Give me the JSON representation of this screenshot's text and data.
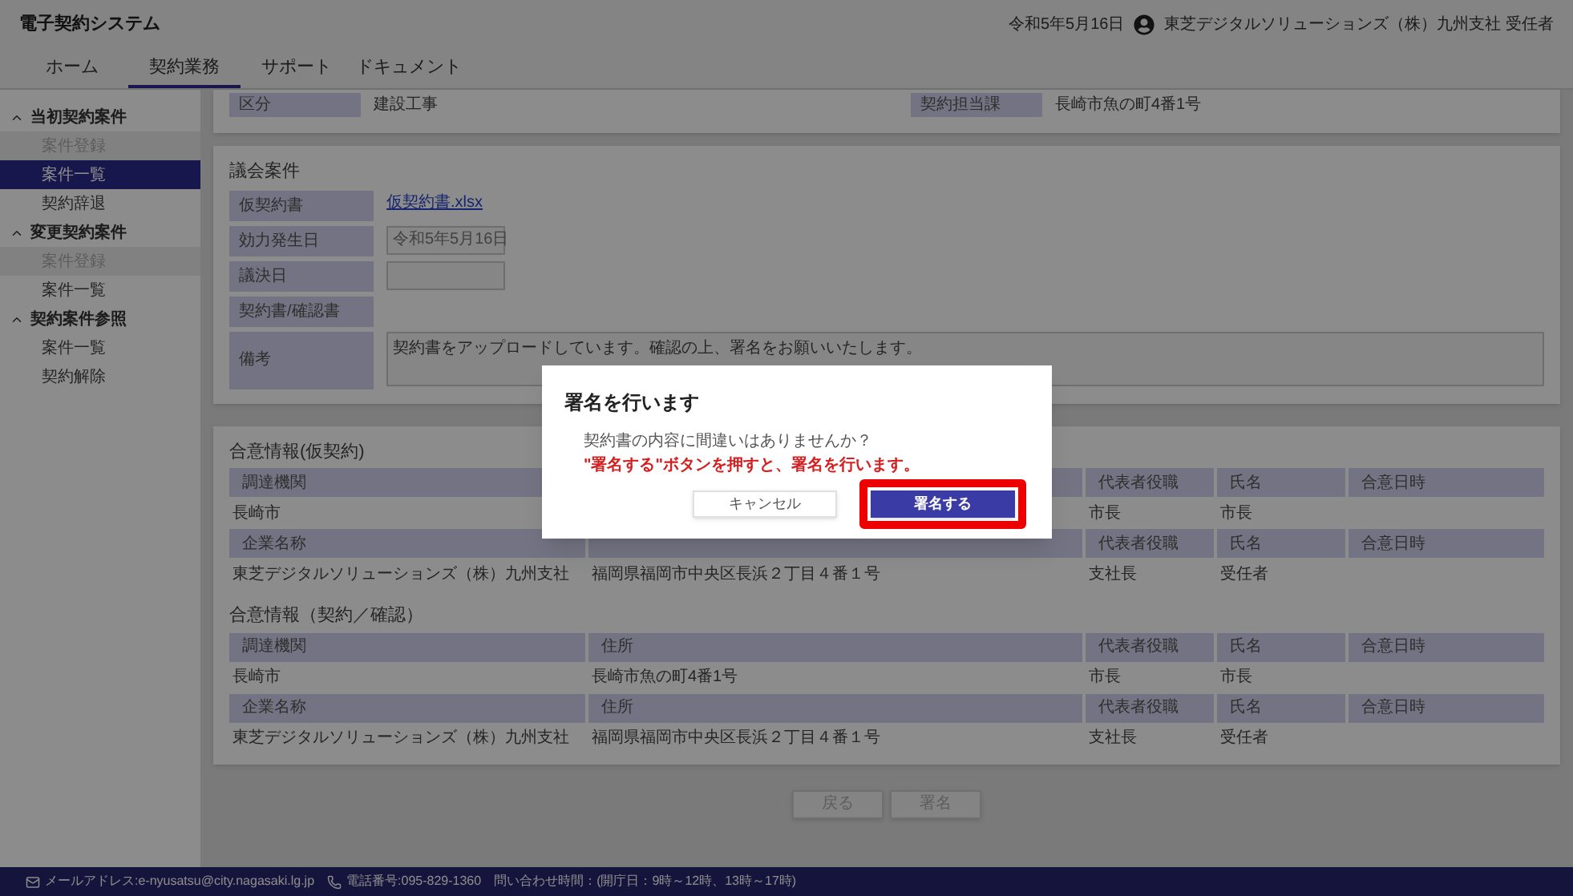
{
  "header": {
    "title": "電子契約システム",
    "date": "令和5年5月16日",
    "user": "東芝デジタルソリューションズ（株）九州支社 受任者"
  },
  "tabs": [
    {
      "label": "ホーム",
      "selected": false
    },
    {
      "label": "契約業務",
      "selected": true
    },
    {
      "label": "サポート",
      "selected": false
    },
    {
      "label": "ドキュメント",
      "selected": false
    }
  ],
  "sidebar": {
    "groups": [
      {
        "label": "当初契約案件",
        "expanded": true,
        "items": [
          {
            "label": "案件登録",
            "selected": false,
            "disabled": true
          },
          {
            "label": "案件一覧",
            "selected": true,
            "disabled": false
          },
          {
            "label": "契約辞退",
            "selected": false,
            "disabled": false
          }
        ]
      },
      {
        "label": "変更契約案件",
        "expanded": true,
        "items": [
          {
            "label": "案件登録",
            "selected": false,
            "disabled": true
          },
          {
            "label": "案件一覧",
            "selected": false,
            "disabled": false
          }
        ]
      },
      {
        "label": "契約案件参照",
        "expanded": true,
        "items": [
          {
            "label": "案件一覧",
            "selected": false,
            "disabled": false
          },
          {
            "label": "契約解除",
            "selected": false,
            "disabled": false
          }
        ]
      }
    ]
  },
  "basic_info": {
    "fields": [
      {
        "label": "区分",
        "value": "建設工事"
      },
      {
        "label": "契約担当課",
        "value": "長崎市魚の町4番1号"
      }
    ]
  },
  "council_case": {
    "title": "議会案件",
    "fields": [
      {
        "label": "仮契約書",
        "kind": "link",
        "value": "仮契約書.xlsx"
      },
      {
        "label": "効力発生日",
        "kind": "input",
        "value": "令和5年5月16日"
      },
      {
        "label": "議決日",
        "kind": "input"
      },
      {
        "label": "契約書/確認書",
        "kind": "text"
      },
      {
        "label": "備考",
        "kind": "textarea",
        "value": "契約書をアップロードしています。確認の上、署名をお願いいたします。"
      }
    ]
  },
  "agreements": [
    {
      "title": "合意情報(仮契約)",
      "rows": [
        {
          "cells": [
            {
              "header": "調達機関",
              "value": "長崎市"
            },
            {},
            {
              "header": "代表者役職",
              "value": "市長"
            },
            {
              "header": "氏名",
              "value": "市長"
            },
            {
              "header": "合意日時"
            }
          ]
        },
        {
          "cells": [
            {
              "header": "企業名称",
              "value": "東芝デジタルソリューションズ（株）九州支社"
            },
            {
              "value": "福岡県福岡市中央区長浜２丁目４番１号"
            },
            {
              "header": "代表者役職",
              "value": "支社長"
            },
            {
              "header": "氏名",
              "value": "受任者"
            },
            {
              "header": "合意日時"
            }
          ]
        }
      ]
    },
    {
      "title": "合意情報（契約／確認）",
      "rows": [
        {
          "cells": [
            {
              "header": "調達機関",
              "value": "長崎市"
            },
            {
              "header": "住所",
              "value": "長崎市魚の町4番1号"
            },
            {
              "header": "代表者役職",
              "value": "市長"
            },
            {
              "header": "氏名",
              "value": "市長"
            },
            {
              "header": "合意日時"
            }
          ]
        },
        {
          "cells": [
            {
              "header": "企業名称",
              "value": "東芝デジタルソリューションズ（株）九州支社"
            },
            {
              "header": "住所",
              "value": "福岡県福岡市中央区長浜２丁目４番１号"
            },
            {
              "header": "代表者役職",
              "value": "支社長"
            },
            {
              "header": "氏名",
              "value": "受任者"
            },
            {
              "header": "合意日時"
            }
          ]
        }
      ]
    }
  ],
  "actions": [
    {
      "label": "戻る",
      "disabled": true
    },
    {
      "label": "署名",
      "disabled": true
    }
  ],
  "modal": {
    "title": "署名を行います",
    "message": "契約書の内容に間違いはありませんか？",
    "warning": "\"署名する\"ボタンを押すと、署名を行います。",
    "buttons": [
      {
        "label": "キャンセル",
        "kind": "secondary",
        "highlighted": false
      },
      {
        "label": "署名する",
        "kind": "primary",
        "highlighted": true
      }
    ]
  },
  "footer": [
    {
      "kind": "email",
      "text": "メールアドレス:e-nyusatsu@city.nagasaki.lg.jp"
    },
    {
      "kind": "phone",
      "text": "電話番号:095-829-1360"
    },
    {
      "kind": "text",
      "text": "問い合わせ時間：(開庁日：9時～12時、13時～17時)"
    }
  ]
}
